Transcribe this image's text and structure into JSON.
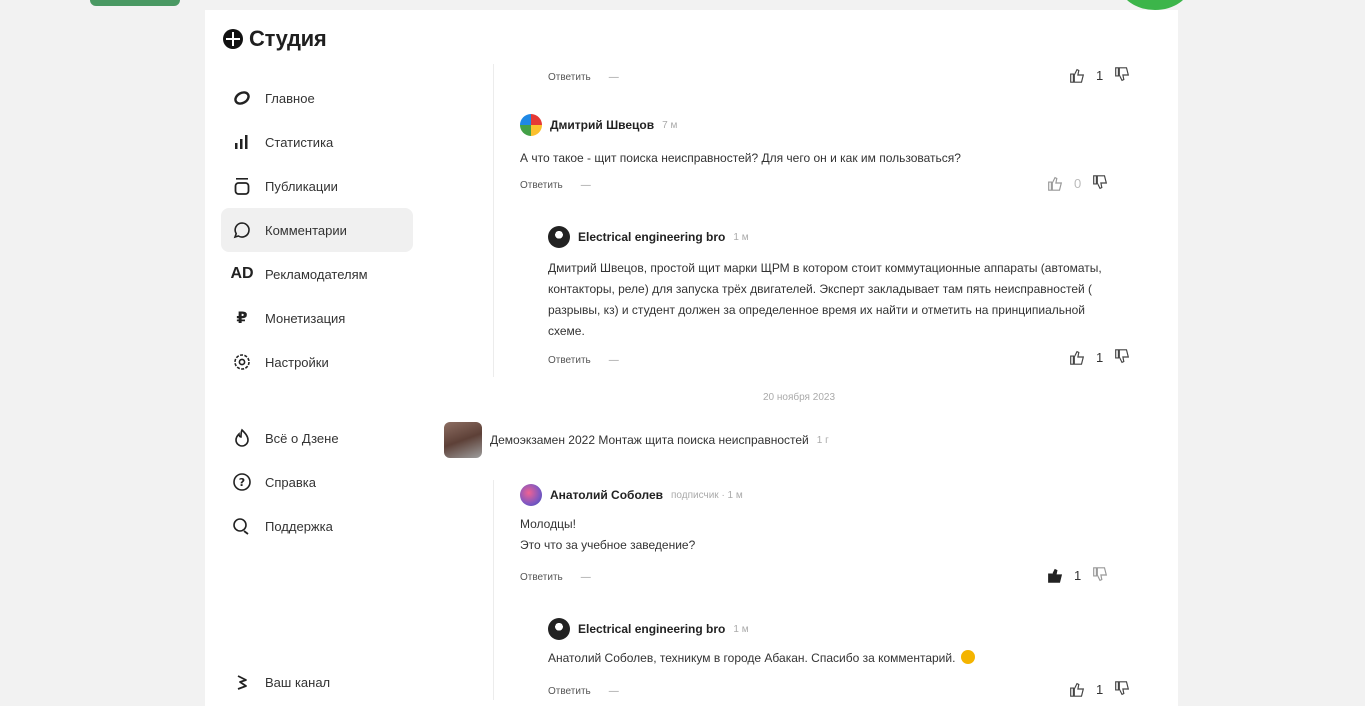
{
  "brand": {
    "name": "Студия"
  },
  "nav_main": [
    {
      "label": "Главное",
      "icon": "spiral-icon"
    },
    {
      "label": "Статистика",
      "icon": "bar-chart-icon"
    },
    {
      "label": "Публикации",
      "icon": "publications-icon"
    },
    {
      "label": "Комментарии",
      "icon": "comment-icon",
      "active": true
    },
    {
      "label": "Рекламодателям",
      "icon": "ad-icon"
    },
    {
      "label": "Монетизация",
      "icon": "ruble-icon"
    },
    {
      "label": "Настройки",
      "icon": "gear-icon"
    }
  ],
  "nav_secondary": [
    {
      "label": "Всё о Дзене",
      "icon": "fire-icon"
    },
    {
      "label": "Справка",
      "icon": "help-icon"
    },
    {
      "label": "Поддержка",
      "icon": "support-icon"
    }
  ],
  "nav_bottom": {
    "label": "Ваш канал",
    "icon": "channel-icon"
  },
  "reply_label": "Ответить",
  "dash": "—",
  "comments": [
    {
      "reply": "Ответить",
      "likes": "1"
    },
    {
      "author": "Дмитрий Швецов",
      "meta": "7 м",
      "text": "А что такое - щит поиска неисправностей? Для чего он и как им пользоваться?",
      "reply": "Ответить",
      "likes": "0"
    },
    {
      "author": "Electrical engineering bro",
      "meta": "1 м",
      "text": "Дмитрий Швецов, простой щит марки ЩРМ в котором стоит коммутационные аппараты (автоматы, контакторы, реле) для запуска трёх двигателей. Эксперт закладывает там пять неисправностей ( разрывы, кз) и студент должен за определенное время их найти и отметить на принципиальной схеме.",
      "reply": "Ответить",
      "likes": "1"
    }
  ],
  "date_separator": "20 ноября 2023",
  "video": {
    "title": "Демоэкзамен 2022 Монтаж щита поиска неисправностей",
    "meta": "1 г"
  },
  "comments2": [
    {
      "author": "Анатолий Соболев",
      "meta": "подписчик · 1 м",
      "text_line1": "Молодцы!",
      "text_line2": "Это что за учебное заведение?",
      "reply": "Ответить",
      "likes": "1"
    },
    {
      "author": "Electrical engineering bro",
      "meta": "1 м",
      "text": "Анатолий Соболев, техникум в городе Абакан. Спасибо за комментарий.",
      "reply": "Ответить",
      "likes": "1"
    }
  ],
  "colors": {
    "active_bg": "#f0f0f0",
    "page_bg": "#f2f2f2"
  }
}
